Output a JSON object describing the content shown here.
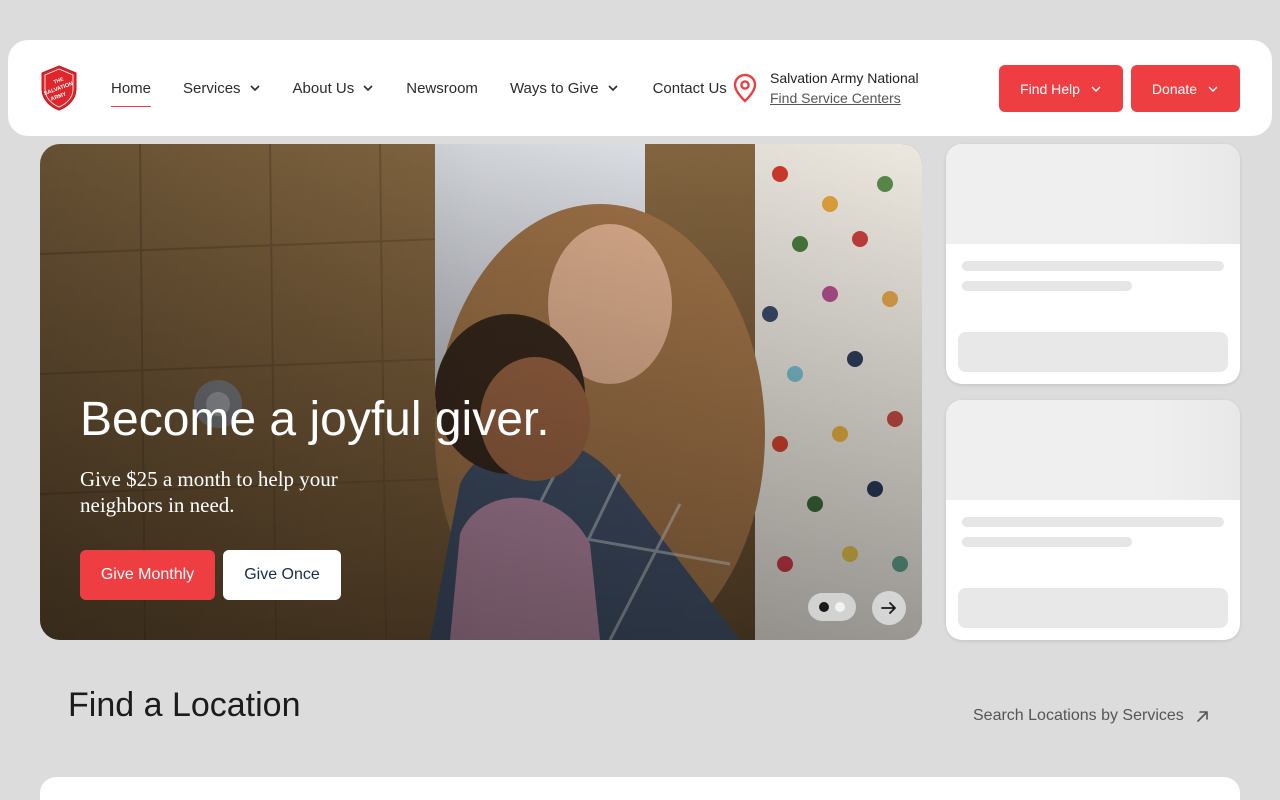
{
  "header": {
    "logo_alt": "The Salvation Army",
    "nav": [
      {
        "label": "Home",
        "active": true,
        "dropdown": false
      },
      {
        "label": "Services",
        "active": false,
        "dropdown": true
      },
      {
        "label": "About Us",
        "active": false,
        "dropdown": true
      },
      {
        "label": "Newsroom",
        "active": false,
        "dropdown": false
      },
      {
        "label": "Ways to Give",
        "active": false,
        "dropdown": true
      },
      {
        "label": "Contact Us",
        "active": false,
        "dropdown": false
      }
    ],
    "location": {
      "name": "Salvation Army National",
      "link": "Find Service Centers"
    },
    "find_help_label": "Find Help",
    "donate_label": "Donate"
  },
  "hero": {
    "title": "Become a joyful giver.",
    "subtitle": "Give $25 a month to help your neighbors in need.",
    "give_monthly_label": "Give Monthly",
    "give_once_label": "Give Once",
    "slide_count": 2,
    "active_slide": 1
  },
  "find_location": {
    "title": "Find a Location",
    "search_link": "Search Locations by Services"
  },
  "colors": {
    "brand_red": "#ef3e42",
    "page_bg": "#dcdcdc",
    "dark_navy": "#1a2b4a"
  },
  "icons": {
    "location": "map-pin-icon",
    "dropdown": "chevron-down-icon",
    "next": "arrow-right-icon",
    "external": "arrow-up-right-icon"
  }
}
